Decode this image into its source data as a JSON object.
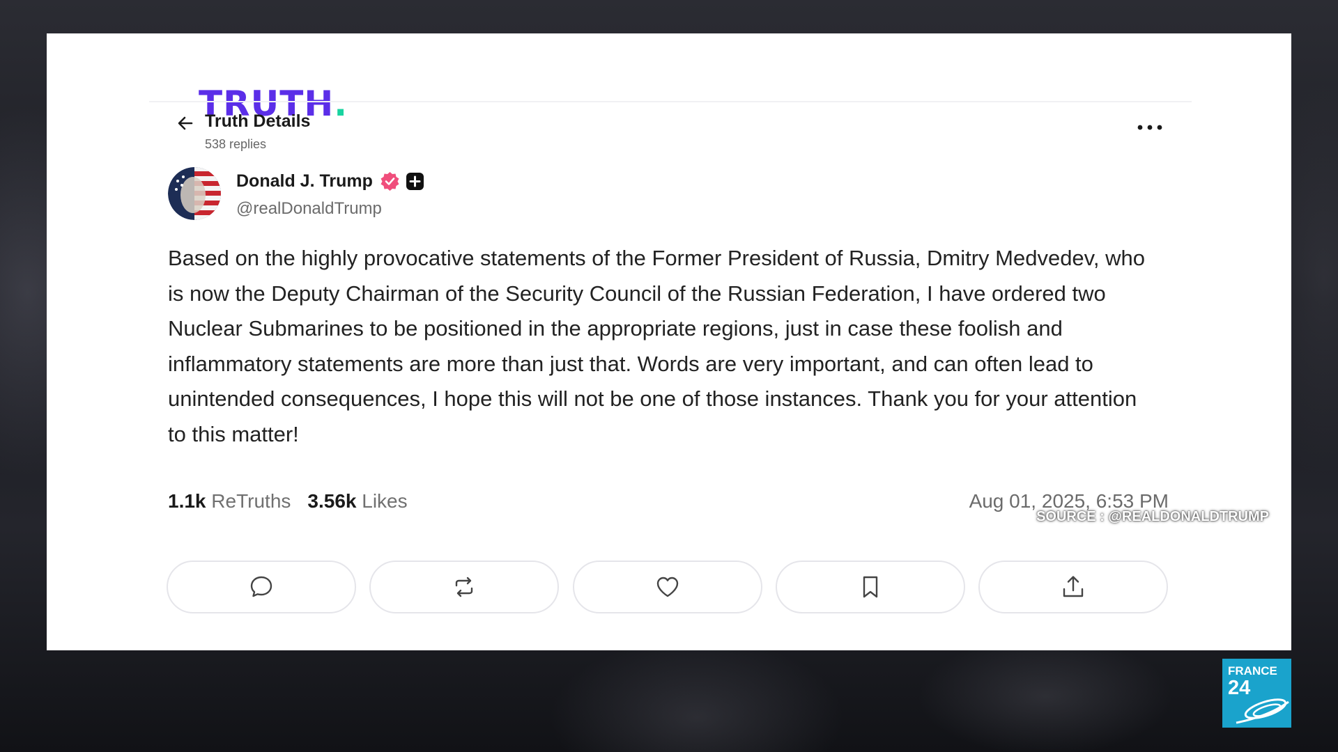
{
  "header": {
    "logo": "TRUTH",
    "logo_dot": ".",
    "title": "Truth Details",
    "subtitle": "538 replies"
  },
  "post": {
    "author_name": "Donald J. Trump",
    "author_handle": "@realDonaldTrump",
    "text": "Based on the highly provocative statements of the Former President of Russia, Dmitry Medvedev, who is now the Deputy Chairman of the Security Council of the Russian Federation, I have ordered two Nuclear Submarines to be positioned in the appropriate regions, just in case these foolish and inflammatory statements are more than just that. Words are very important, and can often lead to unintended consequences, I hope this will not be one of those instances. Thank you for your attention to this matter!",
    "retruths_count": "1.1k",
    "retruths_label": "ReTruths",
    "likes_count": "3.56k",
    "likes_label": "Likes",
    "timestamp": "Aug 01, 2025, 6:53 PM"
  },
  "actions": [
    {
      "icon": "reply-icon"
    },
    {
      "icon": "retruth-icon"
    },
    {
      "icon": "like-icon"
    },
    {
      "icon": "bookmark-icon"
    },
    {
      "icon": "share-icon"
    }
  ],
  "overlay": {
    "source": "SOURCE : @REALDONALDTRUMP",
    "channel_line1": "FRANCE",
    "channel_line2": "24"
  },
  "colors": {
    "brand": "#5b2ee8",
    "brand_dot": "#19d3a0",
    "verified": "#f04e7c",
    "france24": "#1aa3cc"
  }
}
